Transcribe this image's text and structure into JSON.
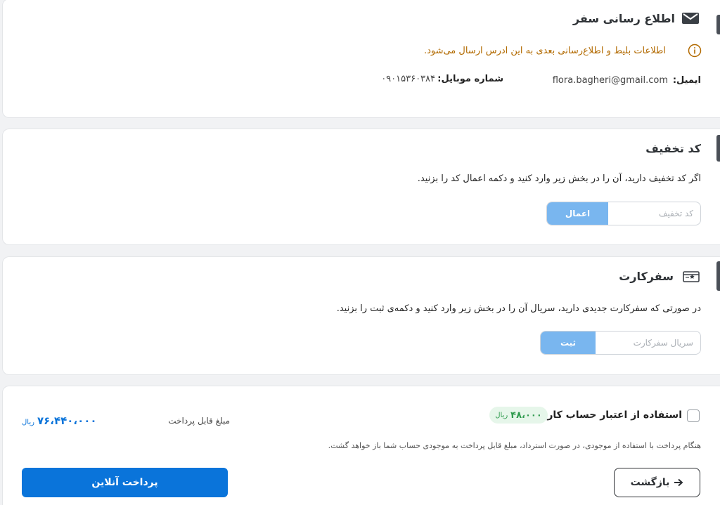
{
  "notify": {
    "title": "اطلاع رسانی سفر",
    "info": "اطلاعات بلیط و اطلاع‌رسانی بعدی به این ادرس ارسال می‌شود.",
    "email_label": "ایمیل:",
    "email_value": "flora.bagheri@gmail.com",
    "mobile_label": "شماره موبایل:",
    "mobile_value": "۰۹۰۱۵۳۶۰۳۸۴"
  },
  "discount": {
    "title": "کد تخفیف",
    "description": "اگر کد تخفیف دارید، آن را در بخش زیر وارد کنید و دکمه اعمال کد را بزنید.",
    "placeholder": "کد تخفیف",
    "button": "اعمال"
  },
  "safarcard": {
    "title": "سفرکارت",
    "description": "در صورتی که سفرکارت جدیدی دارید، سریال آن را در بخش زیر وارد کنید و دکمه‌ی ثبت را بزنید.",
    "placeholder": "سریال سفرکارت",
    "button": "ثبت"
  },
  "payment": {
    "use_credit_label": "استفاده از اعتبار حساب کاربری",
    "credit_amount": "۴۸،۰۰۰",
    "credit_currency": "ریال",
    "payable_label": "مبلغ قابل پرداخت",
    "payable_amount": "۷۶،۴۴۰،۰۰۰",
    "payable_currency": "ریال",
    "refund_note": "هنگام پرداخت با استفاده از موجودی، در صورت استرداد، مبلغ قابل پرداخت به موجودی حساب شما باز خواهد گشت.",
    "back_button": "بازگشت",
    "pay_button": "پرداخت آنلاین"
  },
  "colors": {
    "primary": "#0a74da",
    "apply_button": "#79b6ef",
    "info_text": "#b26a00",
    "amount_text": "#0a74da",
    "credit_green": "#2e9a4d"
  },
  "icons": [
    "envelope-icon",
    "info-icon",
    "ticket-card-icon",
    "arrow-right-icon"
  ]
}
